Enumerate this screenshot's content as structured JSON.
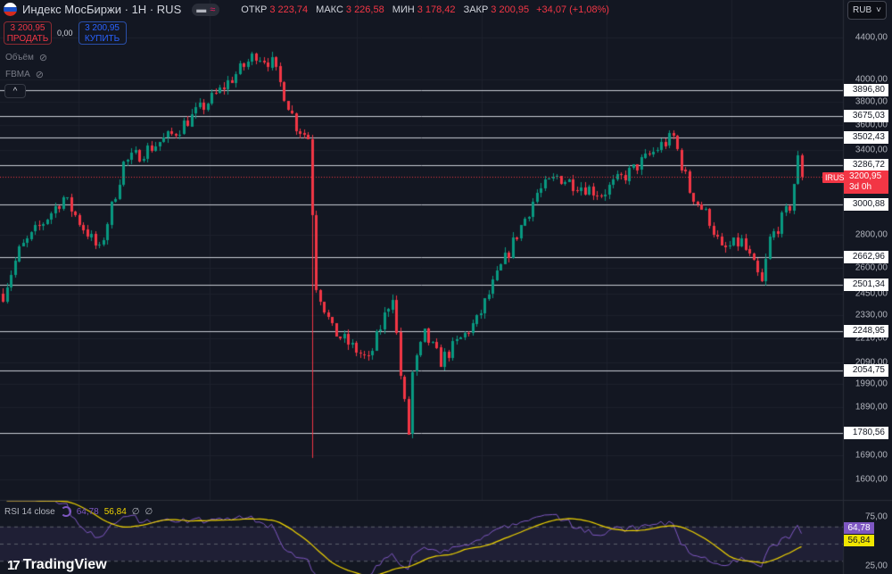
{
  "header": {
    "symbol": "Индекс МосБиржи",
    "interval": "1H",
    "exchange": "RUS",
    "separator": "·",
    "mode_a": "▬",
    "mode_b": "≈",
    "open_label": "ОТКР",
    "open": "3 223,74",
    "high_label": "МАКС",
    "high": "3 226,58",
    "low_label": "МИН",
    "low": "3 178,42",
    "close_label": "ЗАКР",
    "close": "3 200,95",
    "change": "+34,07 (+1,08%)"
  },
  "trade": {
    "sell_price": "3 200,95",
    "sell_label": "ПРОДАТЬ",
    "spread": "0,00",
    "buy_price": "3 200,95",
    "buy_label": "КУПИТЬ"
  },
  "indicators": [
    {
      "label": "Объём",
      "icon": "eye-crossed-icon"
    },
    {
      "label": "FBMA",
      "icon": "eye-crossed-icon"
    }
  ],
  "currency": "RUB",
  "colors": {
    "up": "#089981",
    "down": "#f23645",
    "rsi": "#7e57c2",
    "rsi_ma": "#f0d400",
    "level": "#d1d4dc"
  },
  "price_axis": {
    "ticks": [
      "4400,00",
      "4000,00",
      "3800,00",
      "3600,00",
      "3400,00",
      "2800,00",
      "2600,00",
      "2450,00",
      "2330,00",
      "2210,00",
      "2090,00",
      "1990,00",
      "1890,00",
      "1690,00",
      "1600,00"
    ],
    "tick_values": [
      4400,
      4000,
      3800,
      3600,
      3400,
      2800,
      2600,
      2450,
      2330,
      2210,
      2090,
      1990,
      1890,
      1690,
      1600
    ],
    "range": [
      1520,
      4560
    ]
  },
  "levels": [
    {
      "value": 3896.8,
      "label": "3896,80"
    },
    {
      "value": 3675.03,
      "label": "3675,03"
    },
    {
      "value": 3502.43,
      "label": "3502,43"
    },
    {
      "value": 3286.72,
      "label": "3286,72"
    },
    {
      "value": 3000.88,
      "label": "3000,88"
    },
    {
      "value": 2662.96,
      "label": "2662,96"
    },
    {
      "value": 2501.34,
      "label": "2501,34"
    },
    {
      "value": 2248.95,
      "label": "2248,95"
    },
    {
      "value": 2054.75,
      "label": "2054,75"
    },
    {
      "value": 1780.56,
      "label": "1780,56"
    }
  ],
  "current": {
    "tag": "IRUS",
    "value": 3200.95,
    "label": "3200,95",
    "countdown": "3d 0h"
  },
  "chart_data": {
    "type": "candlestick",
    "scale": "log",
    "candles": 200,
    "waypoints": [
      [
        0,
        2450
      ],
      [
        4,
        2700
      ],
      [
        15,
        3050
      ],
      [
        24,
        2700
      ],
      [
        30,
        3300
      ],
      [
        42,
        3520
      ],
      [
        53,
        3860
      ],
      [
        63,
        4240
      ],
      [
        67,
        4150
      ],
      [
        73,
        3600
      ],
      [
        76,
        3500
      ],
      [
        78,
        2500
      ],
      [
        82,
        2250
      ],
      [
        91,
        2100
      ],
      [
        97,
        2450
      ],
      [
        99,
        2030
      ],
      [
        101,
        1780
      ],
      [
        102,
        2040
      ],
      [
        105,
        2230
      ],
      [
        109,
        2100
      ],
      [
        118,
        2300
      ],
      [
        124,
        2600
      ],
      [
        133,
        3080
      ],
      [
        138,
        3200
      ],
      [
        149,
        3080
      ],
      [
        156,
        3230
      ],
      [
        164,
        3440
      ],
      [
        167,
        3500
      ],
      [
        171,
        3100
      ],
      [
        176,
        2900
      ],
      [
        179,
        2700
      ],
      [
        184,
        2760
      ],
      [
        189,
        2500
      ],
      [
        191,
        2770
      ],
      [
        196,
        2990
      ],
      [
        198,
        3330
      ],
      [
        199,
        3200.95
      ]
    ],
    "spike_low": {
      "index": 77,
      "value": 1680
    }
  },
  "rsi": {
    "label": "RSI 14 close",
    "value": "64,78",
    "ma": "56,84",
    "extra1": "∅",
    "extra2": "∅",
    "upper": "75,00",
    "lower": "25,00"
  },
  "brand": {
    "name": "TradingView",
    "mark": "17"
  }
}
